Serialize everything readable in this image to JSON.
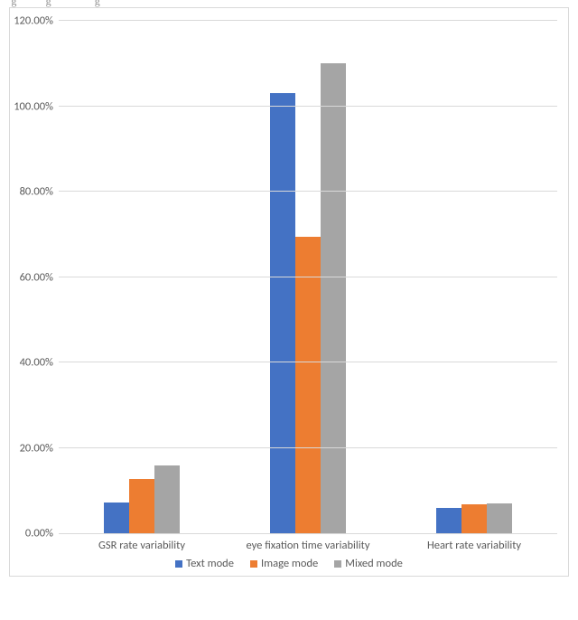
{
  "caption_fragment": "  g          g               g",
  "chart_data": {
    "type": "bar",
    "categories": [
      "GSR rate variability",
      "eye fixation time variability",
      "Heart rate variability"
    ],
    "series": [
      {
        "name": "Text mode",
        "values": [
          7.2,
          103.0,
          6.0
        ]
      },
      {
        "name": "Image mode",
        "values": [
          12.8,
          69.5,
          6.8
        ]
      },
      {
        "name": "Mixed mode",
        "values": [
          15.8,
          110.0,
          7.0
        ]
      }
    ],
    "ylim": [
      0,
      120
    ],
    "y_tick_step": 20,
    "y_tick_format": "0.00%",
    "colors": {
      "Text mode": "#4472c4",
      "Image mode": "#ed7d31",
      "Mixed mode": "#a5a5a5"
    },
    "xlabel": "",
    "ylabel": "",
    "title": "",
    "legend_position": "bottom"
  },
  "y_ticks": [
    {
      "v": 0,
      "label": "0.00%"
    },
    {
      "v": 20,
      "label": "20.00%"
    },
    {
      "v": 40,
      "label": "40.00%"
    },
    {
      "v": 60,
      "label": "60.00%"
    },
    {
      "v": 80,
      "label": "80.00%"
    },
    {
      "v": 100,
      "label": "100.00%"
    },
    {
      "v": 120,
      "label": "120.00%"
    }
  ]
}
